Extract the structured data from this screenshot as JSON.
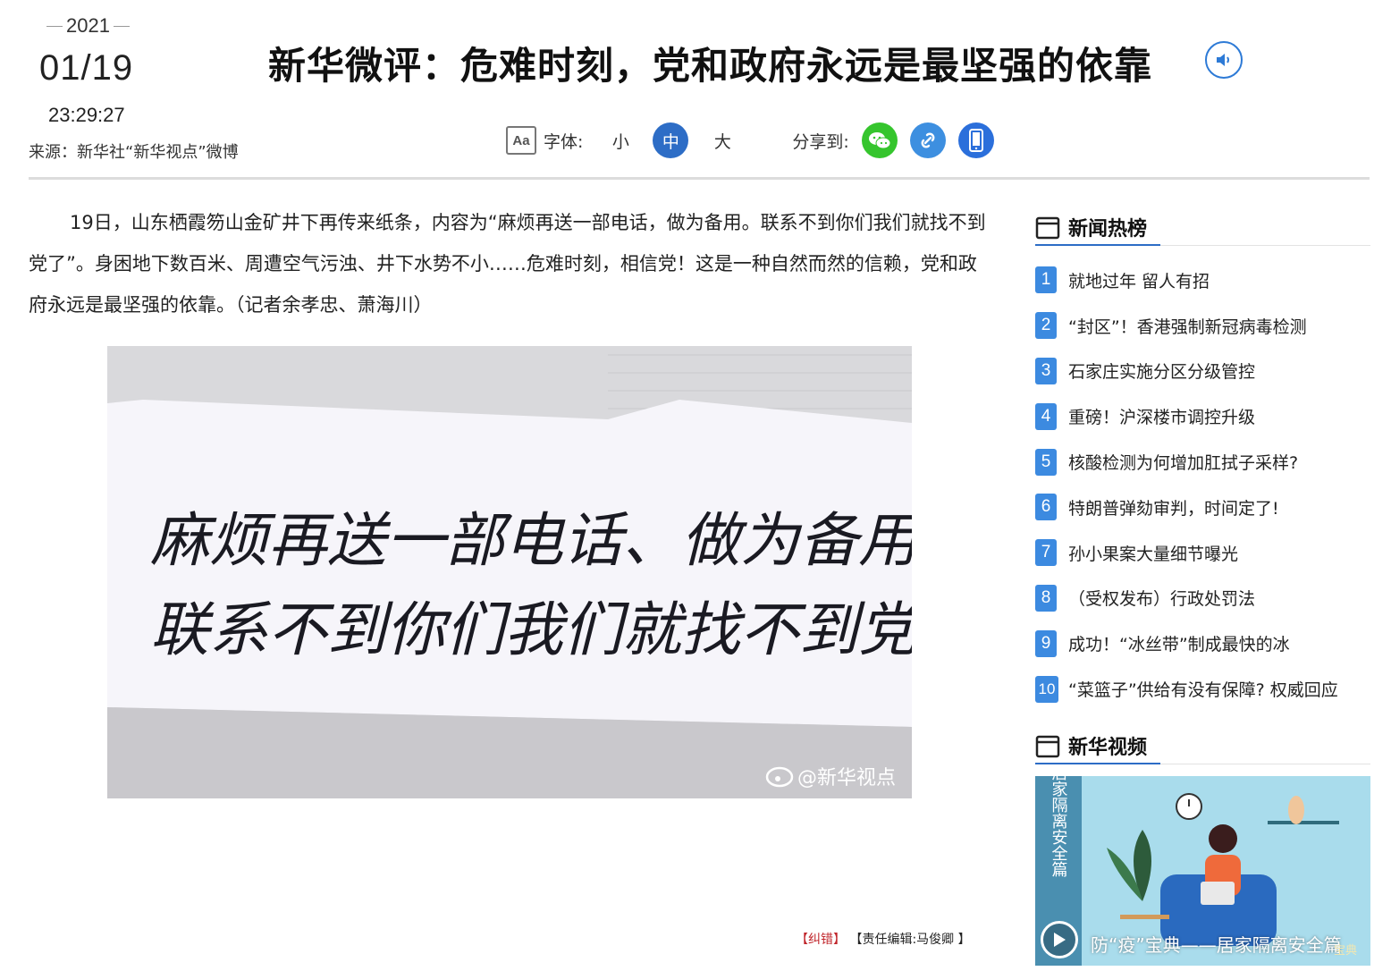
{
  "header": {
    "year": "2021",
    "month_day": "01/19",
    "time": "23:29:27",
    "source": "来源：新华社“新华视点”微博",
    "title": "新华微评：危难时刻，党和政府永远是最坚强的依靠",
    "font_size_label": "字体:",
    "font_small": "小",
    "font_medium": "中",
    "font_large": "大",
    "font_selected": "中",
    "share_label": "分享到:",
    "accent_color": "#2d6dc6"
  },
  "article": {
    "body": "19日，山东栖霞笏山金矿井下再传来纸条，内容为“麻烦再送一部电话，做为备用。联系不到你们我们就找不到党了”。身困地下数百米、周遭空气污浊、井下水势不小……危难时刻，相信党！这是一种自然而然的信赖，党和政府永远是最坚强的依靠。（记者余孝忠、萧海川）",
    "photo": {
      "note_line1": "麻烦再送一部电话、做为备用",
      "note_line2": "联系不到你们我们就找不到党了",
      "watermark": "@新华视点"
    },
    "correction_label": "【纠错】",
    "editor": "【责任编辑:马俊卿 】"
  },
  "sidebar": {
    "hot_title": "新闻热榜",
    "hot_items": [
      {
        "rank": "1",
        "text": "就地过年 留人有招"
      },
      {
        "rank": "2",
        "text": "“封区”！香港强制新冠病毒检测"
      },
      {
        "rank": "3",
        "text": "石家庄实施分区分级管控"
      },
      {
        "rank": "4",
        "text": "重磅！沪深楼市调控升级"
      },
      {
        "rank": "5",
        "text": "核酸检测为何增加肛拭子采样?"
      },
      {
        "rank": "6",
        "text": "特朗普弹劾审判，时间定了!"
      },
      {
        "rank": "7",
        "text": "孙小果案大量细节曝光"
      },
      {
        "rank": "8",
        "text": "（受权发布）行政处罚法"
      },
      {
        "rank": "9",
        "text": "成功！“冰丝带”制成最快的冰"
      },
      {
        "rank": "10",
        "text": "“菜篮子”供给有没有保障? 权威回应"
      }
    ],
    "video_title": "新华视频",
    "video": {
      "caption": "防“疫”宝典——居家隔离安全篇",
      "vertical_title": "居家隔离安全篇",
      "badge": "宝典"
    }
  }
}
